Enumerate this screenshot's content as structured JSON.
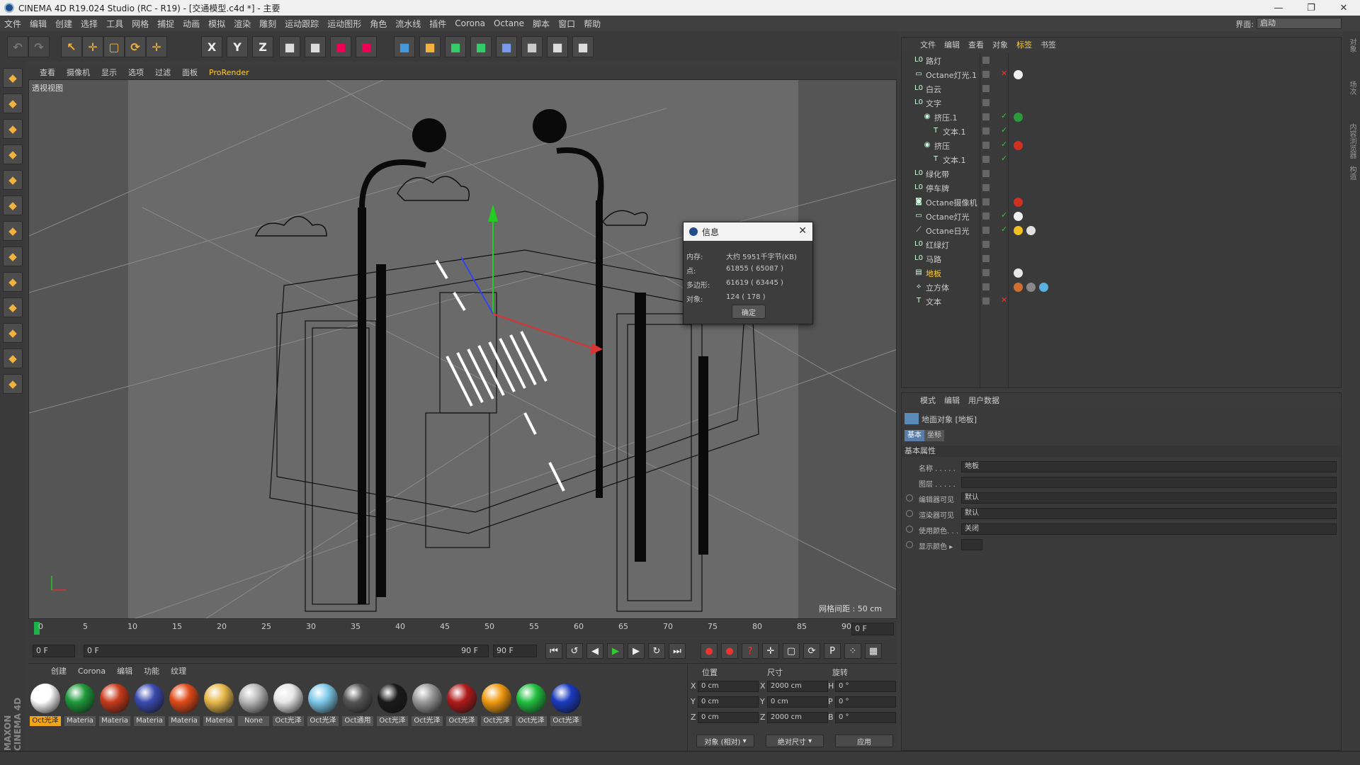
{
  "window": {
    "title": "CINEMA 4D R19.024 Studio (RC - R19) - [交通模型.c4d *] - 主要",
    "controls": [
      "minimize-icon",
      "restore-icon",
      "close-icon"
    ]
  },
  "menubar": {
    "items": [
      "文件",
      "编辑",
      "创建",
      "选择",
      "工具",
      "网格",
      "捕捉",
      "动画",
      "模拟",
      "渲染",
      "雕刻",
      "运动跟踪",
      "运动图形",
      "角色",
      "流水线",
      "插件",
      "Corona",
      "Octane",
      "脚本",
      "窗口",
      "帮助"
    ],
    "layout_label": "界面:",
    "layout_value": "启动"
  },
  "toolbar": {
    "axis_buttons": [
      "X",
      "Y",
      "Z"
    ]
  },
  "viewport": {
    "menu": [
      "查看",
      "摄像机",
      "显示",
      "选项",
      "过滤",
      "面板",
      "ProRender"
    ],
    "highlighted_menu": "ProRender",
    "label": "透视视图",
    "grid_note": "网格间距 : 50 cm",
    "colors": {
      "bg": "#5f5f5f",
      "wire": "#111111",
      "y_axis": "#22cc22"
    }
  },
  "info_dialog": {
    "title": "信息",
    "rows": [
      {
        "label": "内存:",
        "value": "大约 5951千字节(KB)"
      },
      {
        "label": "点:",
        "value": "61855 ( 65087 )"
      },
      {
        "label": "多边形:",
        "value": "61619 ( 63445 )"
      },
      {
        "label": "对象:",
        "value": "124 ( 178 )"
      }
    ],
    "ok_label": "确定"
  },
  "timeline": {
    "ticks": [
      "0",
      "5",
      "10",
      "15",
      "20",
      "25",
      "30",
      "35",
      "40",
      "45",
      "50",
      "55",
      "60",
      "65",
      "70",
      "75",
      "80",
      "85",
      "90"
    ],
    "current_frame": "0 F"
  },
  "transport": {
    "start_field": "0 F",
    "range_start": "0 F",
    "range_end": "90 F",
    "end_field": "90 F"
  },
  "material_manager": {
    "menu": [
      "创建",
      "Corona",
      "编辑",
      "功能",
      "纹理"
    ],
    "materials": [
      {
        "label": "Oct光泽",
        "color": "#ffffff",
        "selected": true
      },
      {
        "label": "Materia",
        "color": "#1e9a3a"
      },
      {
        "label": "Materia",
        "color": "#c83a1a"
      },
      {
        "label": "Materia",
        "color": "#3a4ab0"
      },
      {
        "label": "Materia",
        "color": "#e04a18"
      },
      {
        "label": "Materia",
        "color": "#e8b84a"
      },
      {
        "label": "None",
        "color": "#b8b8b8"
      },
      {
        "label": "Oct光泽",
        "color": "#e6e6e6"
      },
      {
        "label": "Oct光泽",
        "color": "#7cc8e8"
      },
      {
        "label": "Oct通用",
        "color": "#555555"
      },
      {
        "label": "Oct光泽",
        "color": "#1a1a1a"
      },
      {
        "label": "Oct光泽",
        "color": "#9a9a9a"
      },
      {
        "label": "Oct光泽",
        "color": "#b01a1a"
      },
      {
        "label": "Oct光泽",
        "color": "#f09a10"
      },
      {
        "label": "Oct光泽",
        "color": "#20c040"
      },
      {
        "label": "Oct光泽",
        "color": "#1a3ac0"
      }
    ]
  },
  "coordinates": {
    "headers": [
      "位置",
      "尺寸",
      "旋转"
    ],
    "rows": [
      {
        "axis": "X",
        "pos": "0 cm",
        "size_axis": "X",
        "size": "2000 cm",
        "rot_axis": "H",
        "rot": "0 °"
      },
      {
        "axis": "Y",
        "pos": "0 cm",
        "size_axis": "Y",
        "size": "0 cm",
        "rot_axis": "P",
        "rot": "0 °"
      },
      {
        "axis": "Z",
        "pos": "0 cm",
        "size_axis": "Z",
        "size": "2000 cm",
        "rot_axis": "B",
        "rot": "0 °"
      }
    ],
    "mode_select": "对象 (相对)",
    "size_select": "绝对尺寸",
    "apply_label": "应用"
  },
  "object_manager": {
    "menu": [
      "文件",
      "编辑",
      "查看",
      "对象",
      "标签",
      "书签"
    ],
    "highlighted_menu": "标签",
    "objects": [
      {
        "name": "路灯",
        "indent": 0,
        "icon": "null-icon",
        "tags": []
      },
      {
        "name": "Octane灯光.1",
        "indent": 0,
        "icon": "light-icon",
        "tags": [
          "#f0f0f0"
        ],
        "x_red": true
      },
      {
        "name": "白云",
        "indent": 0,
        "icon": "null-icon",
        "tags": []
      },
      {
        "name": "文字",
        "indent": 0,
        "icon": "null-icon",
        "tags": []
      },
      {
        "name": "挤压.1",
        "indent": 1,
        "icon": "extrude-icon",
        "tags": [
          "#2a9a3a"
        ],
        "check": true
      },
      {
        "name": "文本.1",
        "indent": 2,
        "icon": "text-spline-icon",
        "tags": [],
        "check": true
      },
      {
        "name": "挤压",
        "indent": 1,
        "icon": "extrude-icon",
        "tags": [
          "#d03020"
        ],
        "check": true
      },
      {
        "name": "文本.1",
        "indent": 2,
        "icon": "text-spline-icon",
        "tags": [],
        "check": true
      },
      {
        "name": "绿化带",
        "indent": 0,
        "icon": "null-icon",
        "tags": []
      },
      {
        "name": "停车牌",
        "indent": 0,
        "icon": "null-icon",
        "tags": []
      },
      {
        "name": "Octane摄像机",
        "indent": 0,
        "icon": "camera-icon",
        "tags": [
          "#d03020"
        ]
      },
      {
        "name": "Octane灯光",
        "indent": 0,
        "icon": "light-icon",
        "tags": [
          "#f0f0f0"
        ],
        "check": true
      },
      {
        "name": "Octane日光",
        "indent": 0,
        "icon": "sun-icon",
        "tags": [
          "#f0c020",
          "#e0e0e0"
        ],
        "check": true
      },
      {
        "name": "红绿灯",
        "indent": 0,
        "icon": "null-icon",
        "tags": []
      },
      {
        "name": "马路",
        "indent": 0,
        "icon": "null-icon",
        "tags": []
      },
      {
        "name": "地板",
        "indent": 0,
        "icon": "floor-icon",
        "tags": [
          "#e8e8e8"
        ],
        "highlighted": true
      },
      {
        "name": "立方体",
        "indent": 0,
        "icon": "cube-icon",
        "tags": [
          "#d07030",
          "#888888",
          "#5ab0e0"
        ]
      },
      {
        "name": "文本",
        "indent": 0,
        "icon": "text-spline-icon",
        "tags": [],
        "x_red": true
      }
    ]
  },
  "attributes": {
    "menu": [
      "模式",
      "编辑",
      "用户数据"
    ],
    "title": "地面对象 [地板]",
    "tabs": [
      "基本",
      "坐标"
    ],
    "section": "基本属性",
    "fields": [
      {
        "label": "名称 . . . . .",
        "value": "地板",
        "radio": false
      },
      {
        "label": "图层 . . . . .",
        "value": "",
        "radio": false
      },
      {
        "label": "编辑器可见",
        "value": "默认",
        "radio": true
      },
      {
        "label": "渲染器可见",
        "value": "默认",
        "radio": true
      },
      {
        "label": "使用颜色. . .",
        "value": "关闭",
        "radio": true
      },
      {
        "label": "显示颜色 ▸",
        "value": "",
        "radio": true
      }
    ]
  },
  "right_strip": {
    "tabs": [
      "对象",
      "场次",
      "内容浏览器",
      "构造"
    ]
  },
  "brand": "MAXON CINEMA 4D"
}
